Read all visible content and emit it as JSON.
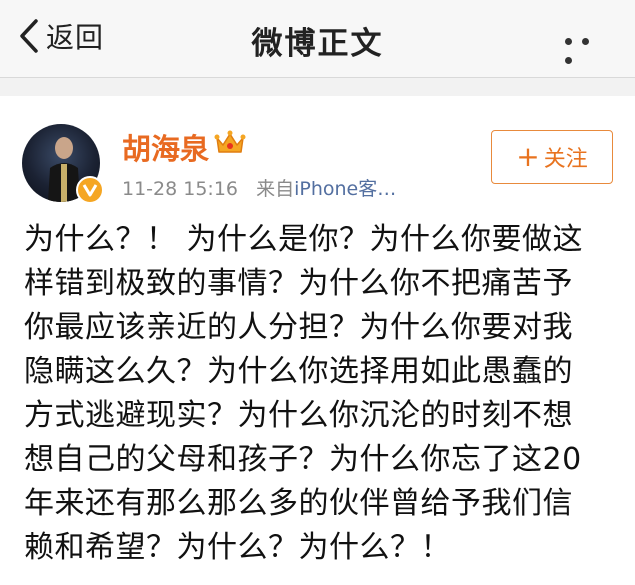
{
  "navbar": {
    "back_label": "返回",
    "title": "微博正文",
    "more_icon": "more-dots-icon"
  },
  "post": {
    "author": {
      "name": "胡海泉",
      "avatar_icon": "avatar",
      "verified_icon": "verified-v-icon",
      "member_icon": "crown-icon"
    },
    "time": "11-28 15:16",
    "source_prefix": "来自",
    "source_name": "iPhone客…",
    "follow_label": "关注",
    "text_lines": [
      "为什么？！ 为什么是你？为什么你要做这",
      "样错到极致的事情？为什么你不把痛苦予",
      "你最应该亲近的人分担？为什么你要对我",
      "隐瞒这么久？为什么你选择用如此愚蠢的",
      "方式逃避现实？为什么你沉沦的时刻不想",
      "想自己的父母和孩子？为什么你忘了这20",
      "年来还有那么那么多的伙伴曾给予我们信",
      "赖和希望？为什么？为什么？！"
    ]
  },
  "colors": {
    "accent": "#e8731f",
    "link": "#536fa0",
    "meta": "#8a8a8a",
    "navbar_bg": "#f7f7f7"
  }
}
